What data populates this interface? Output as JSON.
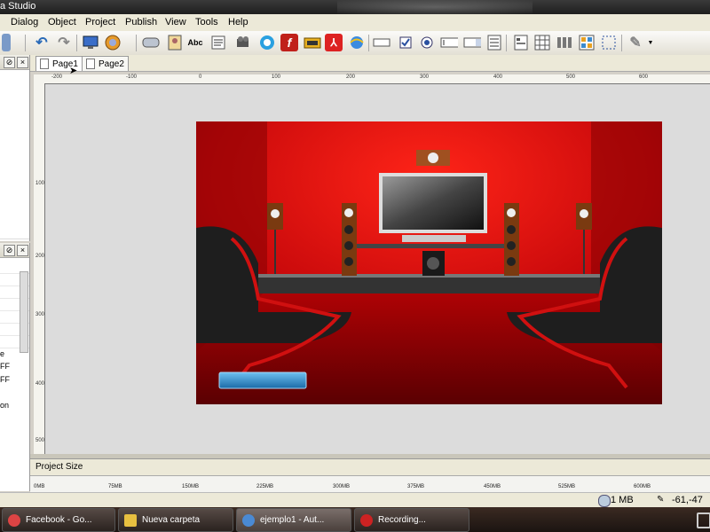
{
  "window": {
    "title_fragment": "a Studio"
  },
  "menu": [
    "Dialog",
    "Object",
    "Project",
    "Publish",
    "View",
    "Tools",
    "Help"
  ],
  "toolbar": {
    "text_button_label": "Abc",
    "icons": [
      "undo-icon",
      "redo-icon",
      "preview-icon",
      "publish-icon",
      "button-icon",
      "image-icon",
      "text-icon",
      "paragraph-icon",
      "video-icon",
      "quicktime-icon",
      "flash-icon",
      "slideshow-icon",
      "pdf-icon",
      "web-icon",
      "inputbox-icon",
      "checkbox-icon",
      "radio-icon",
      "editbox-icon",
      "combobox-icon",
      "list-icon",
      "report-icon",
      "grid-icon",
      "columns-icon",
      "catalog-icon",
      "selection-icon",
      "pencil-icon"
    ]
  },
  "tabs": [
    {
      "label": "Page1"
    },
    {
      "label": "Page2"
    }
  ],
  "left_panel": {
    "fragments": [
      "e",
      "FF",
      "FF",
      "on"
    ]
  },
  "ruler": {
    "top": [
      "-200",
      "-100",
      "0",
      "100",
      "200",
      "300",
      "400",
      "500",
      "600"
    ],
    "left": [
      "100",
      "200",
      "300",
      "400",
      "500"
    ]
  },
  "project_size": {
    "title": "Project Size",
    "ticks": [
      "0MB",
      "75MB",
      "150MB",
      "225MB",
      "300MB",
      "375MB",
      "450MB",
      "525MB",
      "600MB"
    ]
  },
  "status": {
    "size": "1 MB",
    "coords": "-61,-47"
  },
  "taskbar": {
    "items": [
      {
        "label": "Facebook - Go...",
        "color": "#d44"
      },
      {
        "label": "Nueva carpeta",
        "color": "#e8c040"
      },
      {
        "label": "ejemplo1 - Aut...",
        "color": "#4a8ad4"
      },
      {
        "label": "Recording...",
        "color": "#c22"
      }
    ]
  },
  "colors": {
    "scene_red": "#c8090b",
    "button_blue": "#2f8fd0"
  }
}
